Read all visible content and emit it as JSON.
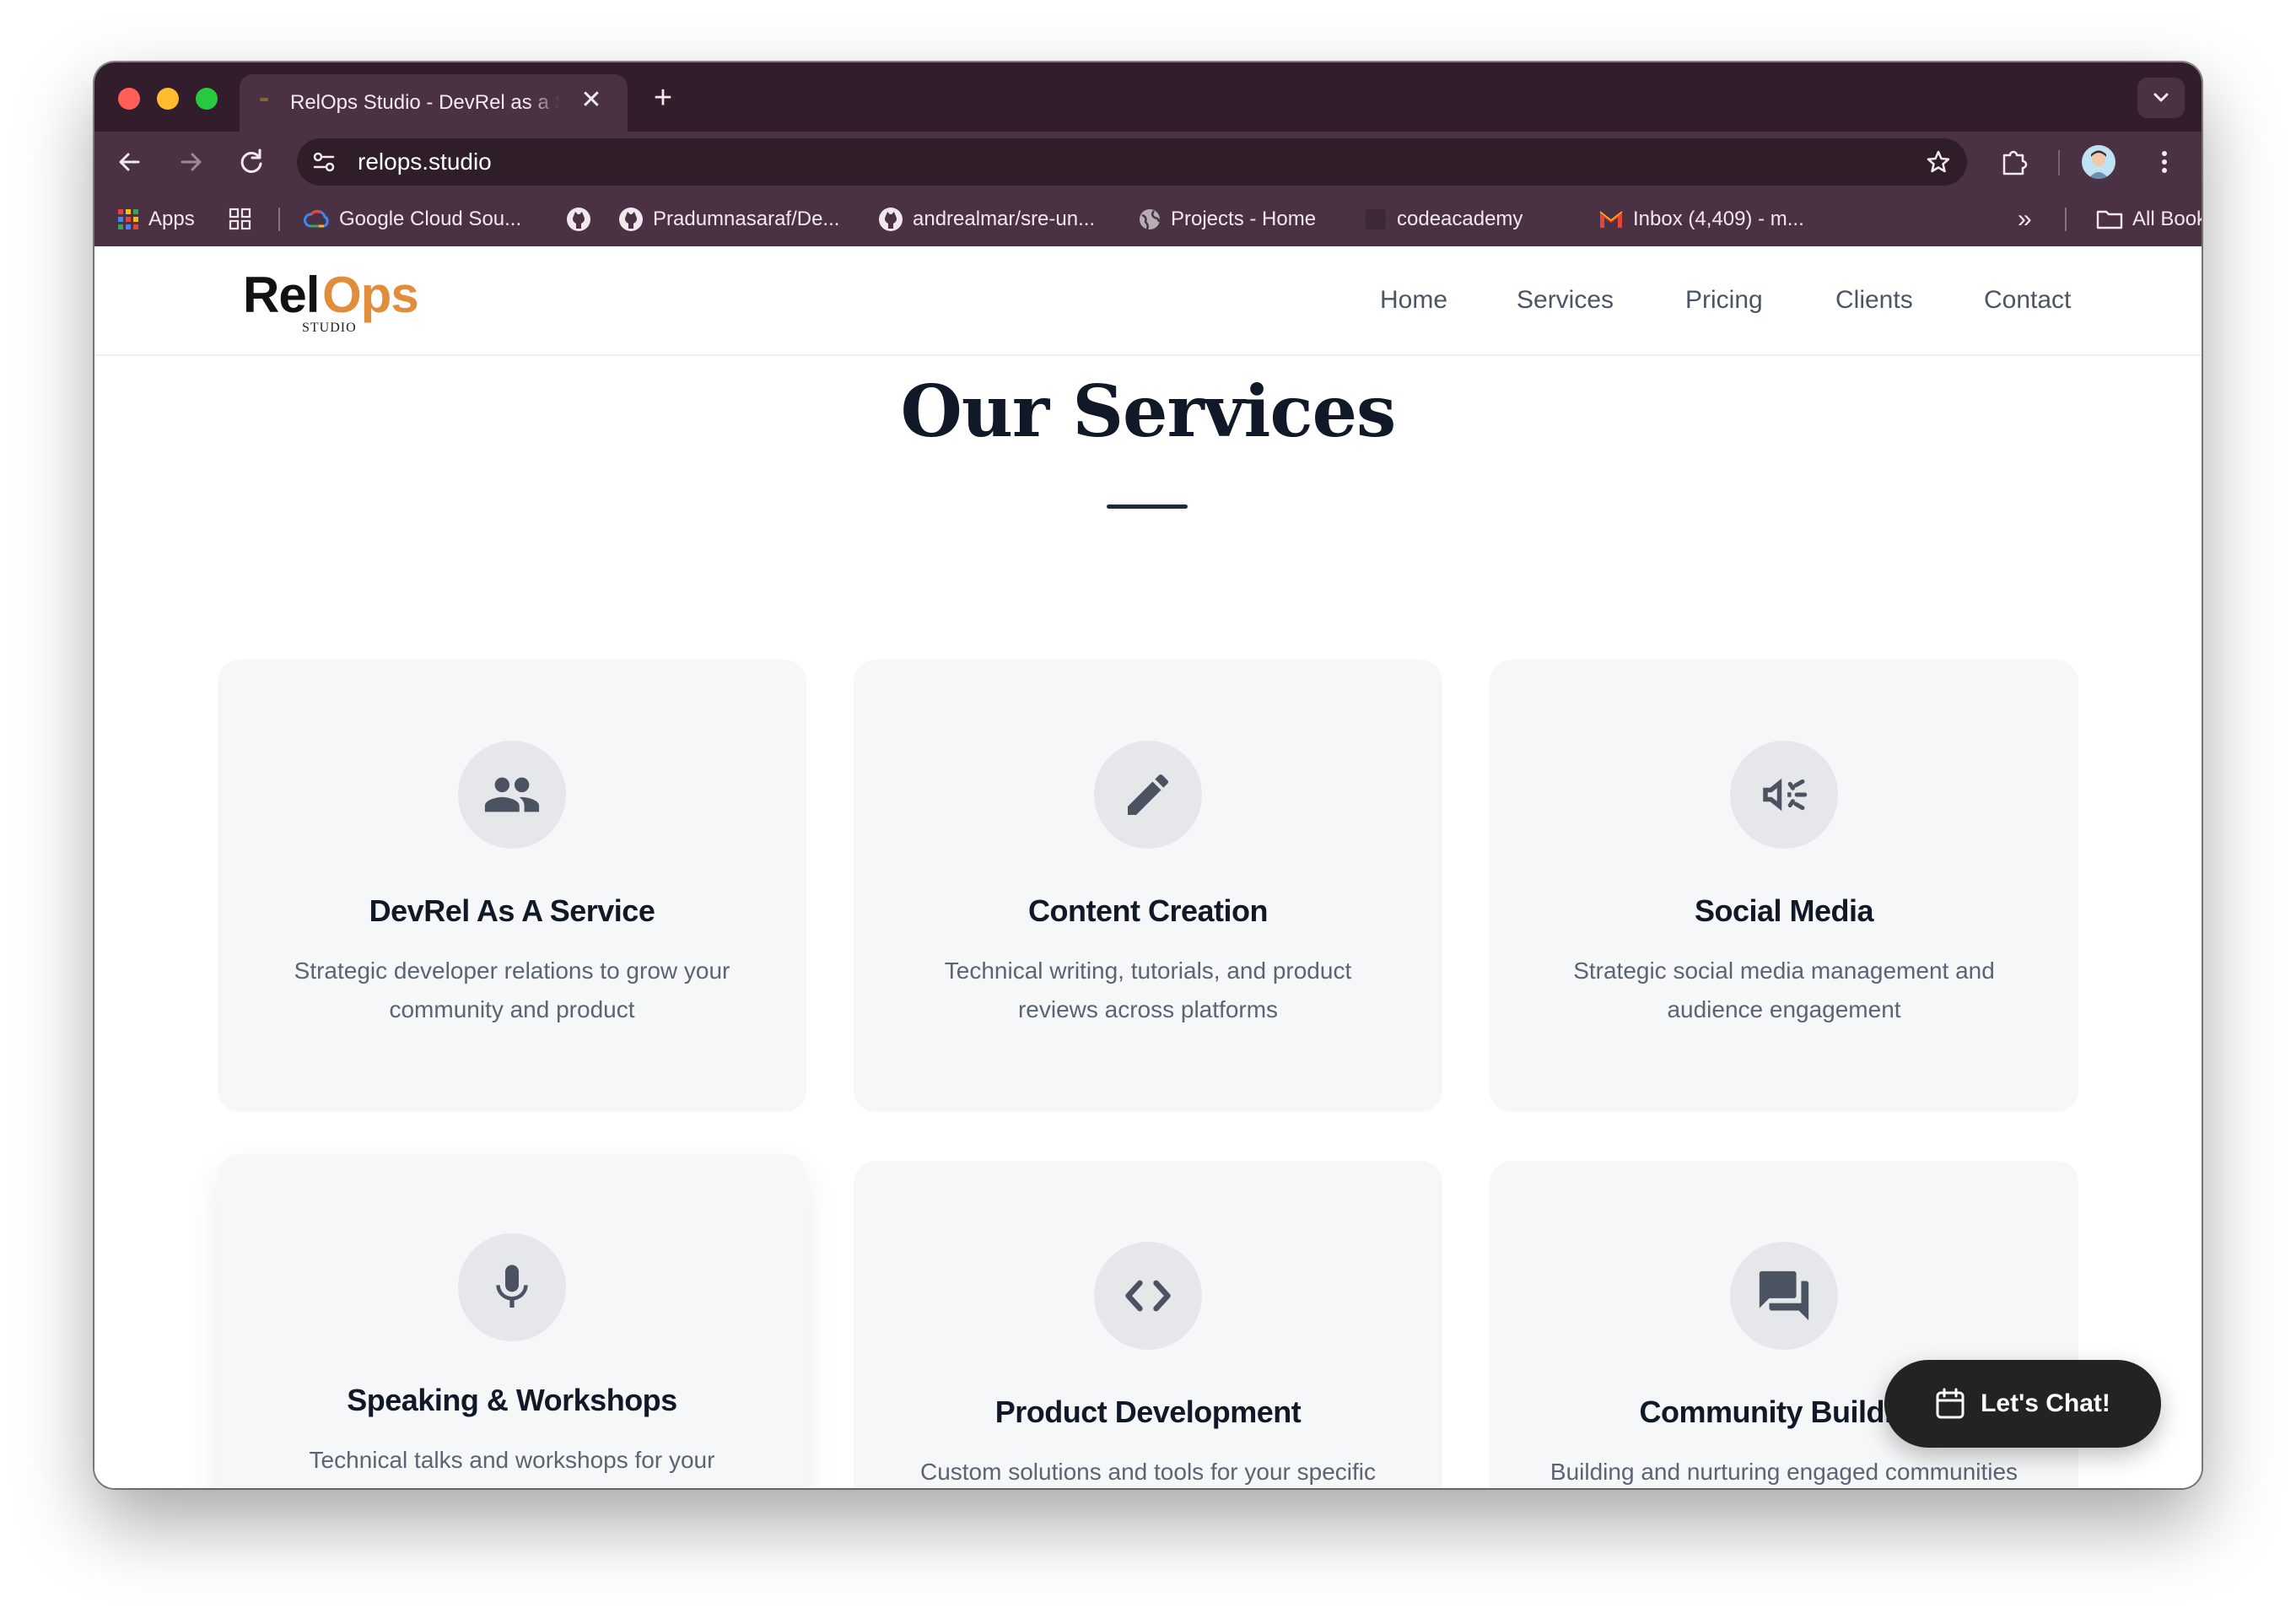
{
  "browser": {
    "tab_title": "RelOps Studio - DevRel as a Service",
    "new_tab": "+",
    "close": "✕",
    "url": "relops.studio"
  },
  "bookmarks": {
    "apps": "Apps",
    "items": [
      "Google Cloud Sou...",
      "Pradumnasaraf/De...",
      "andrealmar/sre-un...",
      "Projects - Home",
      "codeacademy",
      "Inbox (4,409) - m..."
    ],
    "overflow": "»",
    "all_bookmarks": "All Bookmarks"
  },
  "site": {
    "logo_rel": "Rel",
    "logo_ops": "Ops",
    "logo_studio": "STUDIO",
    "nav": [
      "Home",
      "Services",
      "Pricing",
      "Clients",
      "Contact"
    ]
  },
  "services": {
    "title": "Our Services",
    "cards": [
      {
        "icon": "people-icon",
        "title": "DevRel As A Service",
        "desc": "Strategic developer relations to grow your community and product"
      },
      {
        "icon": "pencil-icon",
        "title": "Content Creation",
        "desc": "Technical writing, tutorials, and product reviews across platforms"
      },
      {
        "icon": "megaphone-icon",
        "title": "Social Media",
        "desc": "Strategic social media management and audience engagement"
      },
      {
        "icon": "microphone-icon",
        "title": "Speaking & Workshops",
        "desc": "Technical talks and workshops for your community"
      },
      {
        "icon": "code-icon",
        "title": "Product Development",
        "desc": "Custom solutions and tools for your specific needs"
      },
      {
        "icon": "forum-icon",
        "title": "Community Building",
        "desc": "Building and nurturing engaged communities around your product"
      }
    ]
  },
  "chat": {
    "label": "Let's Chat!"
  },
  "colors": {
    "brand_orange": "#e08e3c",
    "browser_frame": "#4a3244",
    "card_bg": "#f6f7f9"
  }
}
